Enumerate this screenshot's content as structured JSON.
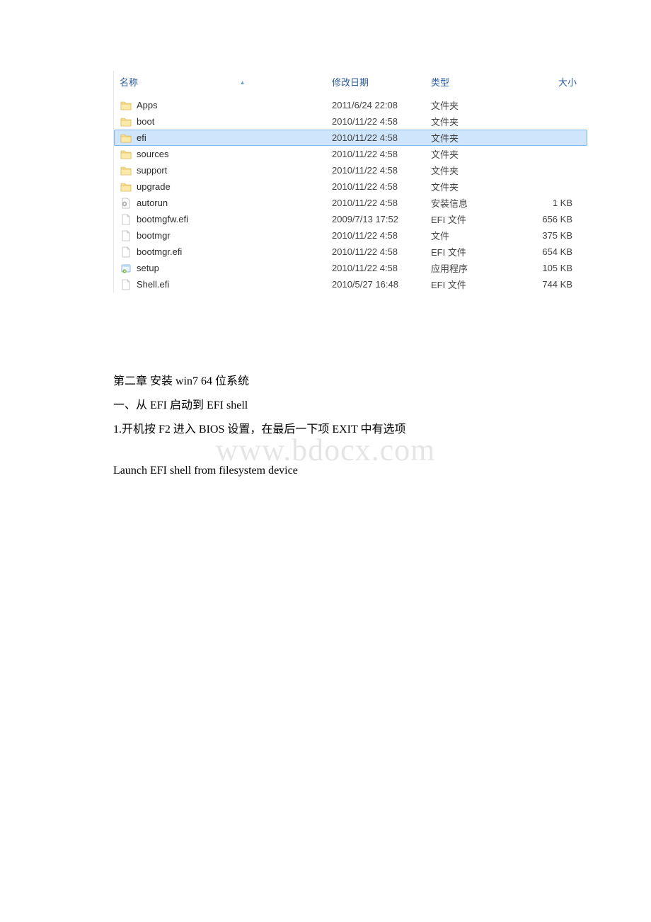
{
  "explorer": {
    "headers": {
      "name": "名称",
      "date": "修改日期",
      "type": "类型",
      "size": "大小"
    },
    "rows": [
      {
        "icon": "folder",
        "name": "Apps",
        "date": "2011/6/24 22:08",
        "type": "文件夹",
        "size": "",
        "selected": false
      },
      {
        "icon": "folder",
        "name": "boot",
        "date": "2010/11/22 4:58",
        "type": "文件夹",
        "size": "",
        "selected": false
      },
      {
        "icon": "folder",
        "name": "efi",
        "date": "2010/11/22 4:58",
        "type": "文件夹",
        "size": "",
        "selected": true
      },
      {
        "icon": "folder",
        "name": "sources",
        "date": "2010/11/22 4:58",
        "type": "文件夹",
        "size": "",
        "selected": false
      },
      {
        "icon": "folder",
        "name": "support",
        "date": "2010/11/22 4:58",
        "type": "文件夹",
        "size": "",
        "selected": false
      },
      {
        "icon": "folder",
        "name": "upgrade",
        "date": "2010/11/22 4:58",
        "type": "文件夹",
        "size": "",
        "selected": false
      },
      {
        "icon": "inf",
        "name": "autorun",
        "date": "2010/11/22 4:58",
        "type": "安装信息",
        "size": "1 KB",
        "selected": false
      },
      {
        "icon": "file",
        "name": "bootmgfw.efi",
        "date": "2009/7/13 17:52",
        "type": "EFI 文件",
        "size": "656 KB",
        "selected": false
      },
      {
        "icon": "file",
        "name": "bootmgr",
        "date": "2010/11/22 4:58",
        "type": "文件",
        "size": "375 KB",
        "selected": false
      },
      {
        "icon": "file",
        "name": "bootmgr.efi",
        "date": "2010/11/22 4:58",
        "type": "EFI 文件",
        "size": "654 KB",
        "selected": false
      },
      {
        "icon": "app",
        "name": "setup",
        "date": "2010/11/22 4:58",
        "type": "应用程序",
        "size": "105 KB",
        "selected": false
      },
      {
        "icon": "file",
        "name": "Shell.efi",
        "date": "2010/5/27 16:48",
        "type": "EFI 文件",
        "size": "744 KB",
        "selected": false
      }
    ]
  },
  "doc": {
    "line1": "第二章 安装 win7 64 位系统",
    "line2": "一、从 EFI 启动到 EFI shell",
    "line3": "1.开机按 F2 进入 BIOS 设置，在最后一下项 EXIT 中有选项",
    "line4": "Launch EFI shell from filesystem device"
  },
  "watermark": "www.bdocx.com"
}
